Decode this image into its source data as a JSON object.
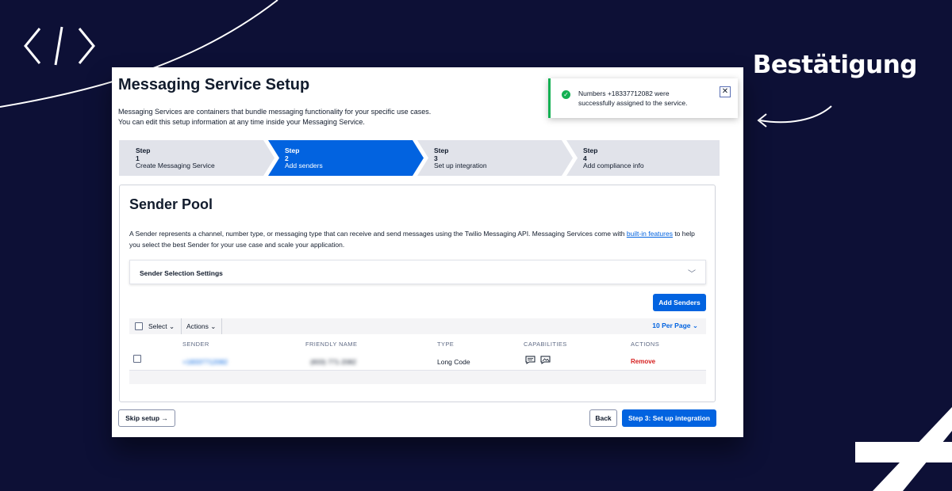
{
  "brand": {
    "heading": "Bestätigung"
  },
  "page": {
    "title": "Messaging Service Setup",
    "description_line1": "Messaging Services are containers that bundle messaging functionality for your specific use cases.",
    "description_line2": "You can edit this setup information at any time inside your Messaging Service."
  },
  "toast": {
    "line1": "Numbers +18337712082 were",
    "line2": "successfully assigned to the service.",
    "close_symbol": "✕",
    "status_color": "#14b053"
  },
  "steps": [
    {
      "number": "Step 1",
      "label": "Create Messaging Service",
      "active": false
    },
    {
      "number": "Step 2",
      "label": "Add senders",
      "active": true
    },
    {
      "number": "Step 3",
      "label": "Set up integration",
      "active": false
    },
    {
      "number": "Step 4",
      "label": "Add compliance info",
      "active": false
    }
  ],
  "sender_pool": {
    "title": "Sender Pool",
    "desc_before_link": "A Sender represents a channel, number type, or messaging type that can receive and send messages using the Twilio Messaging API. Messaging Services come with ",
    "desc_link": "built-in features",
    "desc_after_link": " to help you select the best Sender for your use case and scale your application.",
    "accordion_label": "Sender Selection Settings",
    "add_button": "Add Senders",
    "toolbar": {
      "select": "Select",
      "actions": "Actions",
      "per_page": "10 Per Page"
    },
    "columns": [
      "SENDER",
      "FRIENDLY NAME",
      "TYPE",
      "CAPABILITIES",
      "ACTIONS"
    ],
    "rows": [
      {
        "sender": "+18337712082",
        "friendly_name": "(833) 771-2082",
        "type": "Long Code",
        "capabilities": [
          "sms-icon",
          "mms-icon"
        ],
        "action": "Remove"
      }
    ]
  },
  "footer": {
    "skip": "Skip setup",
    "back": "Back",
    "next": "Step 3: Set up integration"
  },
  "colors": {
    "primary": "#0263e0",
    "background": "#0d1036",
    "danger": "#d61f1f"
  }
}
